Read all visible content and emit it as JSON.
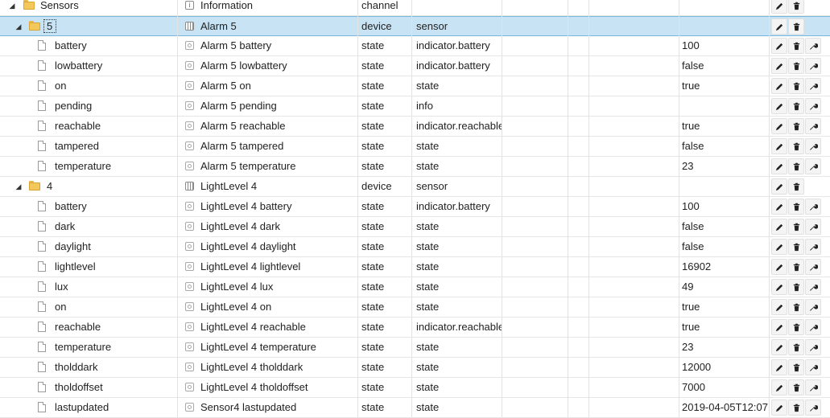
{
  "header_row": {
    "name": "Sensors",
    "col2": "Information",
    "col3": "channel"
  },
  "rows": [
    {
      "level": 1,
      "kind": "folder",
      "expanded": true,
      "selected": true,
      "name": "5",
      "title": "Alarm 5",
      "type": "device",
      "role": "sensor",
      "value": "",
      "buttons": 2,
      "icon": "device"
    },
    {
      "level": 2,
      "kind": "file",
      "name": "battery",
      "title": "Alarm 5 battery",
      "type": "state",
      "role": "indicator.battery",
      "value": "100",
      "buttons": 3,
      "icon": "state"
    },
    {
      "level": 2,
      "kind": "file",
      "name": "lowbattery",
      "title": "Alarm 5 lowbattery",
      "type": "state",
      "role": "indicator.battery",
      "value": "false",
      "buttons": 3,
      "icon": "state"
    },
    {
      "level": 2,
      "kind": "file",
      "name": "on",
      "title": "Alarm 5 on",
      "type": "state",
      "role": "state",
      "value": "true",
      "buttons": 3,
      "icon": "state"
    },
    {
      "level": 2,
      "kind": "file",
      "name": "pending",
      "title": "Alarm 5 pending",
      "type": "state",
      "role": "info",
      "value": "",
      "buttons": 3,
      "icon": "state"
    },
    {
      "level": 2,
      "kind": "file",
      "name": "reachable",
      "title": "Alarm 5 reachable",
      "type": "state",
      "role": "indicator.reachable",
      "value": "true",
      "buttons": 3,
      "icon": "state"
    },
    {
      "level": 2,
      "kind": "file",
      "name": "tampered",
      "title": "Alarm 5 tampered",
      "type": "state",
      "role": "state",
      "value": "false",
      "buttons": 3,
      "icon": "state"
    },
    {
      "level": 2,
      "kind": "file",
      "name": "temperature",
      "title": "Alarm 5 temperature",
      "type": "state",
      "role": "state",
      "value": "23",
      "buttons": 3,
      "icon": "state"
    },
    {
      "level": 1,
      "kind": "folder",
      "expanded": true,
      "name": "4",
      "title": "LightLevel 4",
      "type": "device",
      "role": "sensor",
      "value": "",
      "buttons": 2,
      "icon": "device"
    },
    {
      "level": 2,
      "kind": "file",
      "name": "battery",
      "title": "LightLevel 4 battery",
      "type": "state",
      "role": "indicator.battery",
      "value": "100",
      "buttons": 3,
      "icon": "state"
    },
    {
      "level": 2,
      "kind": "file",
      "name": "dark",
      "title": "LightLevel 4 dark",
      "type": "state",
      "role": "state",
      "value": "false",
      "buttons": 3,
      "icon": "state"
    },
    {
      "level": 2,
      "kind": "file",
      "name": "daylight",
      "title": "LightLevel 4 daylight",
      "type": "state",
      "role": "state",
      "value": "false",
      "buttons": 3,
      "icon": "state"
    },
    {
      "level": 2,
      "kind": "file",
      "name": "lightlevel",
      "title": "LightLevel 4 lightlevel",
      "type": "state",
      "role": "state",
      "value": "16902",
      "buttons": 3,
      "icon": "state"
    },
    {
      "level": 2,
      "kind": "file",
      "name": "lux",
      "title": "LightLevel 4 lux",
      "type": "state",
      "role": "state",
      "value": "49",
      "buttons": 3,
      "icon": "state"
    },
    {
      "level": 2,
      "kind": "file",
      "name": "on",
      "title": "LightLevel 4 on",
      "type": "state",
      "role": "state",
      "value": "true",
      "buttons": 3,
      "icon": "state"
    },
    {
      "level": 2,
      "kind": "file",
      "name": "reachable",
      "title": "LightLevel 4 reachable",
      "type": "state",
      "role": "indicator.reachable",
      "value": "true",
      "buttons": 3,
      "icon": "state"
    },
    {
      "level": 2,
      "kind": "file",
      "name": "temperature",
      "title": "LightLevel 4 temperature",
      "type": "state",
      "role": "state",
      "value": "23",
      "buttons": 3,
      "icon": "state"
    },
    {
      "level": 2,
      "kind": "file",
      "name": "tholddark",
      "title": "LightLevel 4 tholddark",
      "type": "state",
      "role": "state",
      "value": "12000",
      "buttons": 3,
      "icon": "state"
    },
    {
      "level": 2,
      "kind": "file",
      "name": "tholdoffset",
      "title": "LightLevel 4 tholdoffset",
      "type": "state",
      "role": "state",
      "value": "7000",
      "buttons": 3,
      "icon": "state"
    },
    {
      "level": 2,
      "kind": "file",
      "name": "lastupdated",
      "title": "Sensor4 lastupdated",
      "type": "state",
      "role": "state",
      "value": "2019-04-05T12:07",
      "buttons": 3,
      "icon": "state"
    }
  ],
  "icons": {
    "edit": "pencil-icon",
    "delete": "trash-icon",
    "settings": "wrench-icon"
  },
  "colors": {
    "selected_bg": "#c7e3f4",
    "folder": "#f3c75a"
  }
}
